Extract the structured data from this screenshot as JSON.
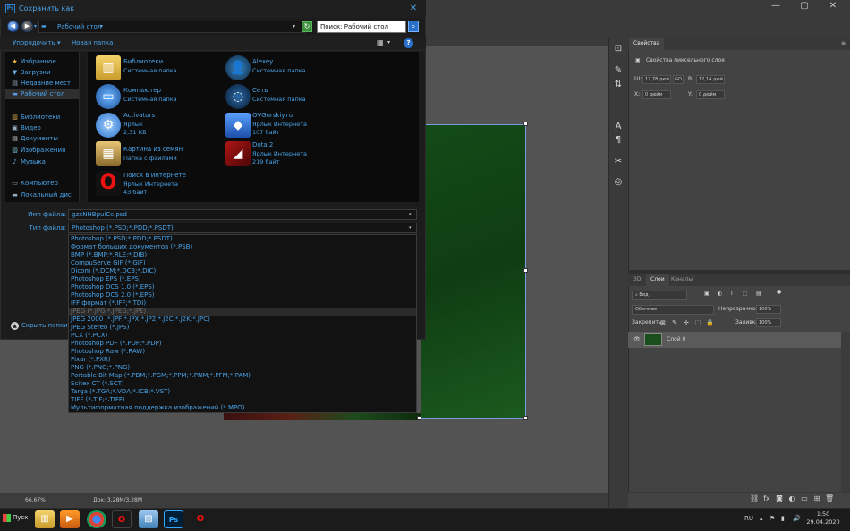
{
  "dialog": {
    "title": "Сохранить как",
    "address": "Рабочий стол",
    "search_placeholder": "Поиск: Рабочий стол",
    "toolbar": {
      "organize": "Упорядочить",
      "new_folder": "Новая папка"
    },
    "nav": {
      "favorites": "Избранное",
      "downloads": "Загрузки",
      "recent": "Недавние мест",
      "desktop": "Рабочий стол",
      "libraries": "Библиотеки",
      "video": "Видео",
      "documents": "Документы",
      "images": "Изображения",
      "music": "Музыка",
      "computer": "Компьютер",
      "local_disk": "Локальный дис"
    },
    "files": [
      {
        "name": "Библиотеки",
        "sub1": "Системная папка",
        "sub2": ""
      },
      {
        "name": "Alexey",
        "sub1": "Системная папка",
        "sub2": ""
      },
      {
        "name": "Компьютер",
        "sub1": "Системная папка",
        "sub2": ""
      },
      {
        "name": "Сеть",
        "sub1": "Системная папка",
        "sub2": ""
      },
      {
        "name": "Activators",
        "sub1": "Ярлык",
        "sub2": "2,31 КБ"
      },
      {
        "name": "OVGorskiy.ru",
        "sub1": "Ярлык Интернета",
        "sub2": "107 байт"
      },
      {
        "name": "Картина из семян",
        "sub1": "Папка с файлами",
        "sub2": ""
      },
      {
        "name": "Dota 2",
        "sub1": "Ярлык Интернета",
        "sub2": "219 байт"
      },
      {
        "name": "Поиск в интернете",
        "sub1": "Ярлык Интернета",
        "sub2": "43 байт"
      }
    ],
    "filename_label": "Имя файла:",
    "filename_value": "gzxNHBpuiCc.psd",
    "filetype_label": "Тип файла:",
    "filetype_value": "Photoshop (*.PSD;*.PDD;*.PSDT)",
    "filetypes": [
      "Photoshop (*.PSD;*.PDD;*.PSDT)",
      "Формат больших документов (*.PSB)",
      "BMP (*.BMP;*.RLE;*.DIB)",
      "CompuServe GIF (*.GIF)",
      "Dicom (*.DCM;*.DC3;*.DIC)",
      "Photoshop EPS (*.EPS)",
      "Photoshop DCS 1.0 (*.EPS)",
      "Photoshop DCS 2.0 (*.EPS)",
      "IFF формат (*.IFF;*.TDI)",
      "JPEG (*.JPG;*.JPEG;*.JPE)",
      "JPEG 2000 (*.JPF;*.JPX;*.JP2;*.J2C;*.J2K;*.JPC)",
      "JPEG Stereo (*.JPS)",
      "PCX (*.PCX)",
      "Photoshop PDF (*.PDF;*.PDP)",
      "Photoshop Raw (*.RAW)",
      "Pixar (*.PXR)",
      "PNG (*.PNG;*.PNG)",
      "Portable Bit Map (*.PBM;*.PGM;*.PPM;*.PNM;*.PFM;*.PAM)",
      "Scitex CT (*.SCT)",
      "Targa (*.TGA;*.VDA;*.ICB;*.VST)",
      "TIFF (*.TIF;*.TIFF)",
      "Мультиформатная поддержка изображений  (*.MPO)"
    ],
    "highlighted_type": "JPEG (*.JPG;*.JPEG;*.JPE)",
    "hide_folders": "Скрыть папки"
  },
  "photoshop": {
    "properties_tab": "Свойства",
    "properties_subtitle": "Свойства пиксельного слоя",
    "w_label": "Ш:",
    "w_value": "17,78 дюй",
    "link_label": "GO",
    "h_label": "В:",
    "h_value": "12,14 дюй",
    "x_label": "X:",
    "x_value": "0 дюйм",
    "y_label": "Y:",
    "y_value": "0 дюйм",
    "panel_tabs": {
      "three_d": "3D",
      "layers": "Слои",
      "channels": "Каналы"
    },
    "kind_filter": "Вид",
    "blend_mode": "Обычные",
    "opacity_label": "Непрозрачность:",
    "opacity_value": "100%",
    "lock_label": "Закрепить:",
    "fill_label": "Заливка:",
    "fill_value": "100%",
    "layer_name": "Слой 0",
    "zoom": "66.67%",
    "doc_info": "Док: 3,28M/3,28M"
  },
  "taskbar": {
    "start": "Пуск",
    "lang": "RU",
    "time": "1:50",
    "date": "29.04.2020",
    "apps": [
      "explorer-icon",
      "media-player-icon",
      "chrome-icon",
      "opera-icon",
      "image-viewer-icon",
      "photoshop-icon",
      "opera-icon"
    ]
  },
  "colors": {
    "accent": "#4aa3e8",
    "dialog_bg": "#1c1c1c",
    "ps_panel": "#434343",
    "ps_bg": "#535353"
  }
}
